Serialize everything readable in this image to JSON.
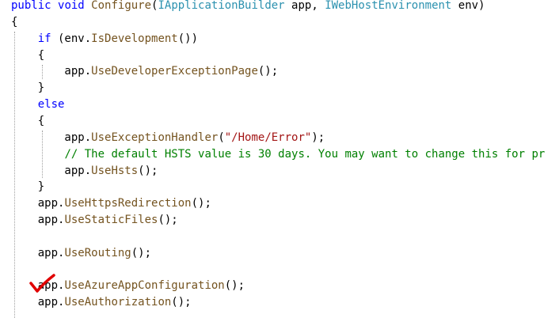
{
  "editor": {
    "colors": {
      "keyword": "#0000ff",
      "type": "#2b91af",
      "method": "#74531f",
      "string": "#a31515",
      "comment": "#008000",
      "plain": "#000000",
      "check_mark": "#e00000"
    },
    "lines": [
      {
        "text": "public void Configure(IApplicationBuilder app, IWebHostEnvironment env)"
      },
      {
        "text": "{"
      },
      {
        "text": "    if (env.IsDevelopment())"
      },
      {
        "text": "    {"
      },
      {
        "text": "        app.UseDeveloperExceptionPage();"
      },
      {
        "text": "    }"
      },
      {
        "text": "    else"
      },
      {
        "text": "    {"
      },
      {
        "text": "        app.UseExceptionHandler(\"/Home/Error\");"
      },
      {
        "text": "        // The default HSTS value is 30 days. You may want to change this for pr"
      },
      {
        "text": "        app.UseHsts();"
      },
      {
        "text": "    }"
      },
      {
        "text": "    app.UseHttpsRedirection();"
      },
      {
        "text": "    app.UseStaticFiles();"
      },
      {
        "text": ""
      },
      {
        "text": "    app.UseRouting();"
      },
      {
        "text": ""
      },
      {
        "text": "    app.UseAzureAppConfiguration();",
        "checked": true
      },
      {
        "text": "    app.UseAuthorization();"
      }
    ]
  }
}
